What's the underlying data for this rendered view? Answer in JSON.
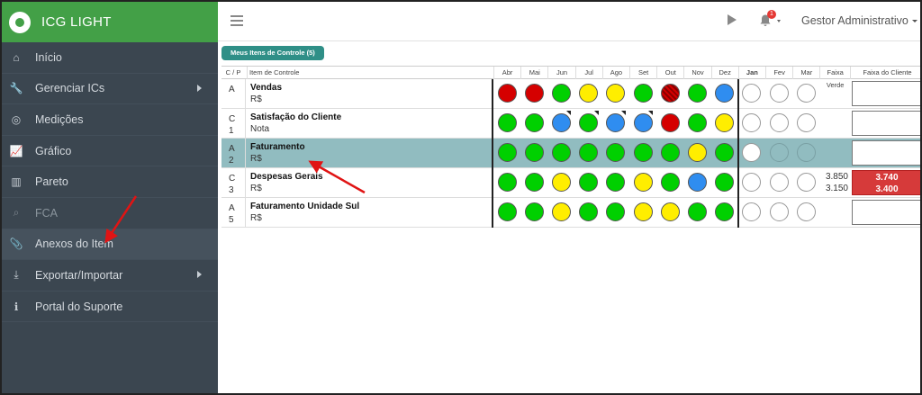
{
  "app": {
    "name": "ICG LIGHT"
  },
  "sidebar": {
    "items": [
      {
        "label": "Início",
        "icon": "home-icon",
        "caret": false,
        "state": "normal"
      },
      {
        "label": "Gerenciar ICs",
        "icon": "wrench-icon",
        "caret": true,
        "state": "normal"
      },
      {
        "label": "Medições",
        "icon": "target-icon",
        "caret": false,
        "state": "normal"
      },
      {
        "label": "Gráfico",
        "icon": "line-chart-icon",
        "caret": false,
        "state": "normal"
      },
      {
        "label": "Pareto",
        "icon": "bar-chart-icon",
        "caret": false,
        "state": "normal"
      },
      {
        "label": "FCA",
        "icon": "search-icon",
        "caret": false,
        "state": "disabled"
      },
      {
        "label": "Anexos do Item",
        "icon": "paperclip-icon",
        "caret": false,
        "state": "active"
      },
      {
        "label": "Exportar/Importar",
        "icon": "download-icon",
        "caret": true,
        "state": "normal"
      },
      {
        "label": "Portal do Suporte",
        "icon": "info-icon",
        "caret": false,
        "state": "normal"
      }
    ]
  },
  "topbar": {
    "notification_count": "1",
    "user_name": "Gestor Administrativo"
  },
  "tab": {
    "label": "Meus Itens de Controle (5)"
  },
  "grid": {
    "headers": {
      "cp": "C / P",
      "item": "Item de Controle",
      "months": [
        "Abr",
        "Mai",
        "Jun",
        "Jul",
        "Ago",
        "Set",
        "Out",
        "Nov",
        "Dez",
        "Jan",
        "Fev",
        "Mar"
      ],
      "faixa_verde": "Faixa Verde",
      "faixa_cliente": "Faixa do Cliente"
    },
    "rows": [
      {
        "cp_top": "A",
        "cp_bottom": "",
        "name": "Vendas",
        "unit": "R$",
        "dots": [
          "red",
          "red",
          "green",
          "yellow",
          "yellow",
          "green",
          "striped",
          "green",
          "blue",
          "empty",
          "empty",
          "empty"
        ],
        "flags": [],
        "faixa_verde": [
          "",
          ""
        ],
        "faixa_cliente": [
          "",
          ""
        ],
        "selected": false
      },
      {
        "cp_top": "C",
        "cp_bottom": "1",
        "name": "Satisfação do Cliente",
        "unit": "Nota",
        "dots": [
          "green",
          "green",
          "blue",
          "green",
          "blue",
          "blue",
          "red",
          "green",
          "yellow",
          "empty",
          "empty",
          "empty"
        ],
        "flags": [
          2,
          3,
          4,
          5
        ],
        "faixa_verde": [
          "",
          ""
        ],
        "faixa_cliente": [
          "",
          ""
        ],
        "selected": false
      },
      {
        "cp_top": "A",
        "cp_bottom": "2",
        "name": "Faturamento",
        "unit": "R$",
        "dots": [
          "green",
          "green",
          "green",
          "green",
          "green",
          "green",
          "green",
          "yellow",
          "green",
          "empty",
          "empty",
          "empty"
        ],
        "flags": [],
        "faixa_verde": [
          "",
          ""
        ],
        "faixa_cliente": [
          "",
          ""
        ],
        "selected": true
      },
      {
        "cp_top": "C",
        "cp_bottom": "3",
        "name": "Despesas Gerais",
        "unit": "R$",
        "dots": [
          "green",
          "green",
          "yellow",
          "green",
          "green",
          "yellow",
          "green",
          "blue",
          "green",
          "empty",
          "empty",
          "empty"
        ],
        "flags": [],
        "faixa_verde": [
          "3.850",
          "3.150"
        ],
        "faixa_cliente": [
          "3.740",
          "3.400"
        ],
        "selected": false
      },
      {
        "cp_top": "A",
        "cp_bottom": "5",
        "name": "Faturamento Unidade Sul",
        "unit": "R$",
        "dots": [
          "green",
          "green",
          "yellow",
          "green",
          "green",
          "yellow",
          "yellow",
          "green",
          "green",
          "empty",
          "empty",
          "empty"
        ],
        "flags": [],
        "faixa_verde": [
          "",
          ""
        ],
        "faixa_cliente": [
          "",
          ""
        ],
        "selected": false
      }
    ]
  }
}
